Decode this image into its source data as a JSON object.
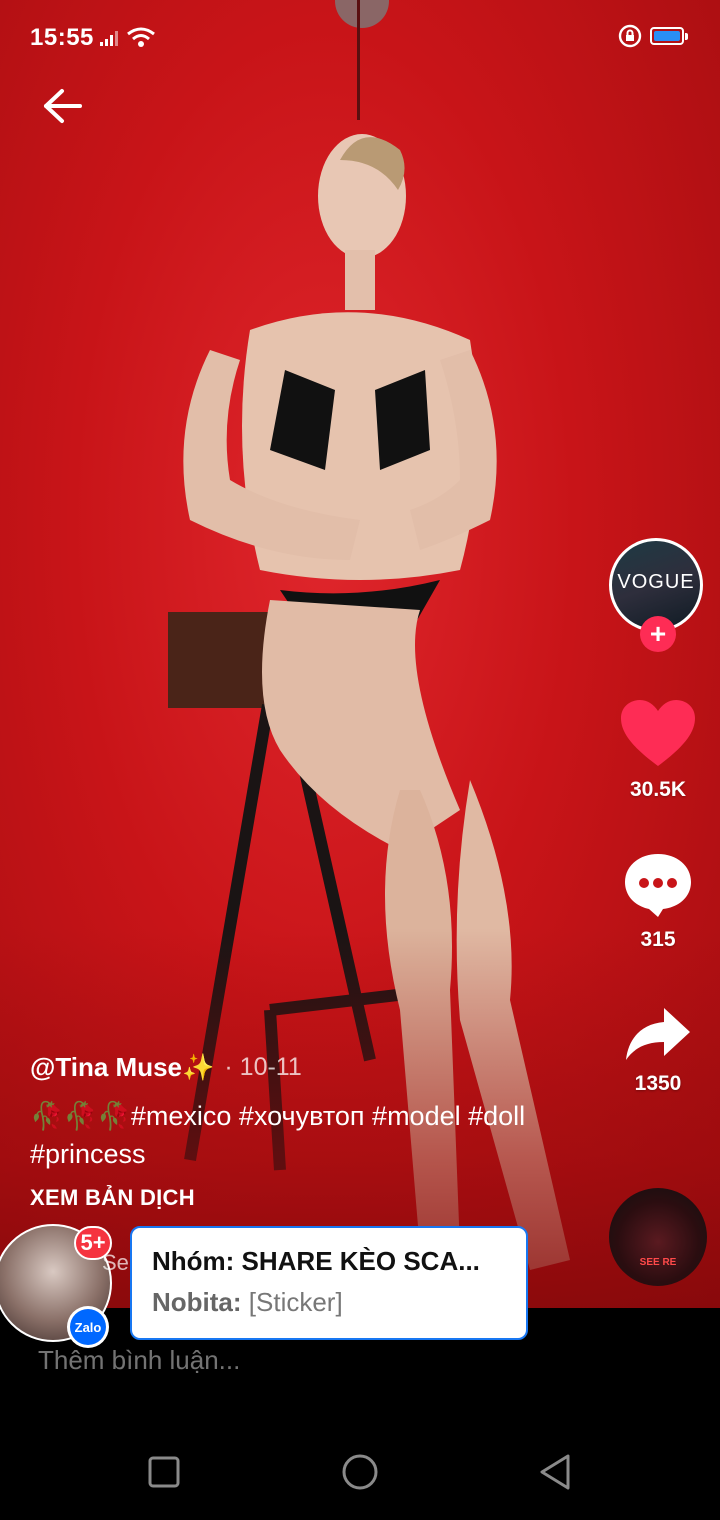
{
  "status_bar": {
    "time": "15:55"
  },
  "creator": {
    "avatar_text": "VOGUE",
    "follow_symbol": "+"
  },
  "actions": {
    "likes": "30.5K",
    "comments": "315",
    "shares": "1350"
  },
  "caption": {
    "username": "@Tina Muse",
    "sparkle": "✨",
    "date": "· 10-11",
    "description": "🥀🥀🥀#mexico #хочувтоп #model #doll #princess",
    "translate_label": "XEM BẢN DỊCH"
  },
  "music": {
    "disc_label": "SEE RE"
  },
  "comment_bar": {
    "placeholder": "Thêm bình luận..."
  },
  "chat_head": {
    "badge": "5+",
    "app_badge": "Zalo",
    "peek_text": "Se"
  },
  "notification": {
    "title": "Nhóm: SHARE KÈO SCA...",
    "sender": "Nobita:",
    "message": "[Sticker]"
  },
  "colors": {
    "accent": "#fe2c55",
    "video_bg": "#c81418",
    "zalo_blue": "#0068ff",
    "battery": "#2a8ef5"
  }
}
